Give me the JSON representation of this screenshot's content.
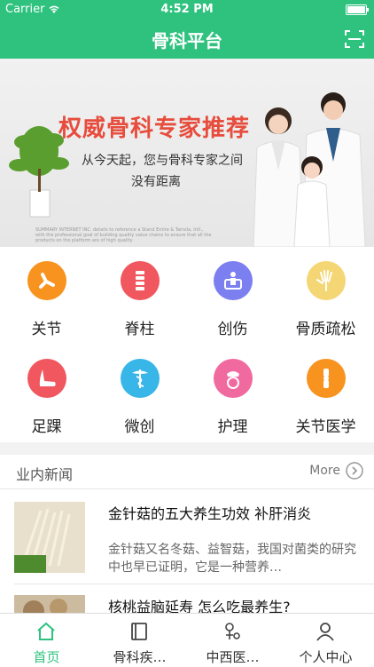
{
  "status": {
    "carrier": "Carrier",
    "time": "4:52 PM"
  },
  "nav": {
    "title": "骨科平台"
  },
  "banner": {
    "headline": "权威骨科专家推荐",
    "line1": "从今天起，您与骨科专家之间",
    "line2": "没有距离",
    "fine": "SUMMARY INTERNET INC. details to reference a Stand Entire & Tamsla, Intl., with the professional goal of building quality value chains to ensure that all the products on the platform are of high quality"
  },
  "categories": [
    {
      "label": "关节",
      "color": "#f7931e",
      "icon": "joint-icon"
    },
    {
      "label": "脊柱",
      "color": "#f0575f",
      "icon": "spine-icon"
    },
    {
      "label": "创伤",
      "color": "#7b7ff0",
      "icon": "trauma-icon"
    },
    {
      "label": "骨质疏松",
      "color": "#f4d675",
      "icon": "hand-bone-icon"
    },
    {
      "label": "足踝",
      "color": "#f0575f",
      "icon": "foot-icon"
    },
    {
      "label": "微创",
      "color": "#38b6e8",
      "icon": "caduceus-icon"
    },
    {
      "label": "护理",
      "color": "#f06aa0",
      "icon": "nurse-icon"
    },
    {
      "label": "关节医学",
      "color": "#f7931e",
      "icon": "knee-icon"
    }
  ],
  "news": {
    "header": "业内新闻",
    "more": "More",
    "items": [
      {
        "title": "金针菇的五大养生功效 补肝消炎",
        "desc": "金针菇又名冬菇、益智菇，我国对菌类的研究中也早已证明，它是一种营养…"
      },
      {
        "title": "核桃益脑延寿 怎么吃最养生?",
        "desc": ""
      }
    ]
  },
  "tabs": [
    {
      "label": "首页",
      "icon": "home-icon"
    },
    {
      "label": "骨科疾…",
      "icon": "book-icon"
    },
    {
      "label": "中西医…",
      "icon": "medicine-icon"
    },
    {
      "label": "个人中心",
      "icon": "person-icon"
    }
  ],
  "colors": {
    "primary": "#2ec27e",
    "headline": "#e74c3c"
  }
}
